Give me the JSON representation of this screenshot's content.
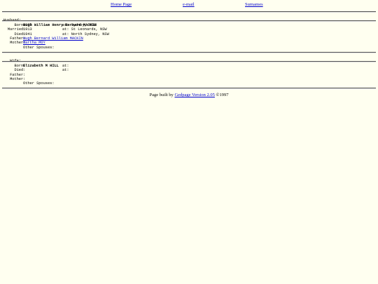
{
  "nav": {
    "home": "Home Page",
    "email": "e-mail",
    "surnames": "Surnames"
  },
  "husband": {
    "label": "Husband:",
    "name": "Hugh William Henry Bernard MACKIN",
    "born_label": "Born:",
    "born_date": "1883",
    "born_at": "at: Sydney, NSW",
    "married_label": "Married:",
    "married_date": "1913",
    "married_at": "at: St Leonards, NSW",
    "died_label": "Died:",
    "died_date": "1941",
    "died_at": "at: North Sydney, NSW",
    "father_label": "Father:",
    "father": "Hugh Bernard William MACKIN",
    "mother_label": "Mother:",
    "mother": "Martha MOY",
    "other_spouses": "Other Spouses:"
  },
  "wife": {
    "label": "Wife:",
    "name": "Elizabeth M HILL",
    "born_label": "Born:",
    "born_at": "at:",
    "died_label": "Died:",
    "died_at": "at:",
    "father_label": "Father:",
    "mother_label": "Mother:",
    "other_spouses": "Other Spouses:"
  },
  "footer": {
    "prefix": "Page built by ",
    "link": "Gedpage Version 2.05",
    "suffix": " ©1997"
  }
}
